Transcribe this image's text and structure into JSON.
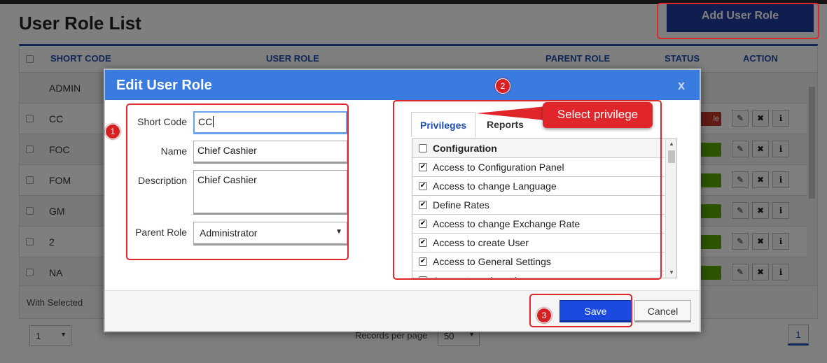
{
  "page": {
    "title": "User Role List",
    "add_button": "Add User Role"
  },
  "table": {
    "headers": {
      "short_code": "SHORT CODE",
      "user_role": "USER ROLE",
      "parent_role": "PARENT ROLE",
      "status": "STATUS",
      "action": "ACTION"
    },
    "rows": [
      {
        "code": "ADMIN",
        "status_color": ""
      },
      {
        "code": "CC",
        "status_color": "#c0392b",
        "status_text": "le"
      },
      {
        "code": "FOC",
        "status_color": "#5aa800"
      },
      {
        "code": "FOM",
        "status_color": "#5aa800"
      },
      {
        "code": "GM",
        "status_color": "#5aa800"
      },
      {
        "code": "2",
        "status_color": "#5aa800"
      },
      {
        "code": "NA",
        "status_color": "#5aa800"
      }
    ],
    "action_icons": [
      "pencil-icon",
      "close-icon",
      "info-icon"
    ]
  },
  "footer": {
    "with_selected": "With Selected",
    "page_select": "1",
    "records_per_page_label": "Records per page",
    "records_per_page_value": "50",
    "current_page": "1"
  },
  "modal": {
    "title": "Edit User Role",
    "close": "x",
    "form": {
      "short_code_label": "Short Code",
      "short_code_value": "CC",
      "name_label": "Name",
      "name_value": "Chief Cashier",
      "description_label": "Description",
      "description_value": "Chief Cashier",
      "parent_role_label": "Parent Role",
      "parent_role_value": "Administrator"
    },
    "tabs": [
      "Privileges",
      "Reports"
    ],
    "privileges": [
      {
        "label": "Configuration",
        "checked": false,
        "header": true
      },
      {
        "label": "Access to Configuration Panel",
        "checked": true
      },
      {
        "label": "Access to change Language",
        "checked": true
      },
      {
        "label": "Define Rates",
        "checked": true
      },
      {
        "label": "Access to change Exchange Rate",
        "checked": true
      },
      {
        "label": "Access to create User",
        "checked": true
      },
      {
        "label": "Access to General Settings",
        "checked": true
      },
      {
        "label": "Access to web settings",
        "checked": false
      }
    ],
    "save": "Save",
    "cancel": "Cancel"
  },
  "annotations": {
    "step1": "1",
    "step2": "2",
    "step3": "3",
    "callout": "Select privilege"
  },
  "colors": {
    "accent": "#3a7be0",
    "save": "#1a4ae0",
    "annotation": "#e0262a"
  }
}
